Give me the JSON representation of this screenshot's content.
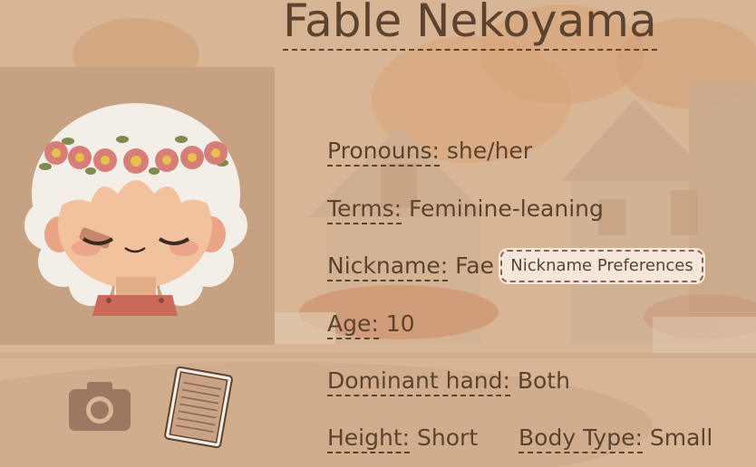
{
  "character": {
    "name": "Fable Nekoyama"
  },
  "profile": {
    "pronouns": {
      "label": "Pronouns:",
      "value": "she/her"
    },
    "terms": {
      "label": "Terms:",
      "value": "Feminine-leaning"
    },
    "nickname": {
      "label": "Nickname:",
      "value": "Fae"
    },
    "age": {
      "label": "Age:",
      "value": "10"
    },
    "dominant_hand": {
      "label": "Dominant hand:",
      "value": "Both"
    },
    "height": {
      "label": "Height:",
      "value": "Short"
    },
    "body_type": {
      "label": "Body Type:",
      "value": "Small"
    }
  },
  "buttons": {
    "nickname_preferences": "Nickname Preferences"
  },
  "icons": {
    "camera": "camera-icon",
    "notebook": "notebook-icon"
  },
  "colors": {
    "text": "#5b4330",
    "background": "#d9b695",
    "portrait_panel": "#c6a283",
    "button_bg": "#f6e6dc"
  }
}
